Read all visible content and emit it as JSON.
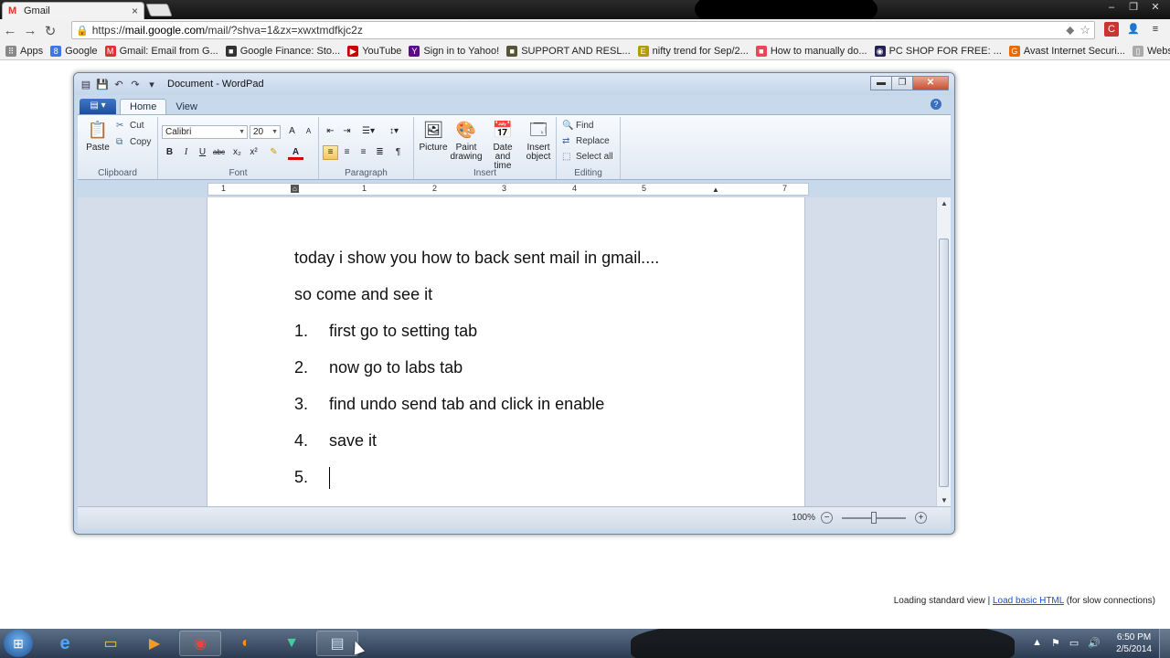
{
  "browser": {
    "tab_title": "Gmail",
    "tab_close": "×",
    "url_prefix": "https://",
    "url_host": "mail.google.com",
    "url_path": "/mail/?shva=1&zx=xwxtmdfkjc2z",
    "back": "←",
    "forward": "→",
    "reload": "↻",
    "window_buttons": [
      "–",
      "❐",
      "✕"
    ],
    "omnibox_icons": [
      "⬥",
      "☆"
    ],
    "extension_icons": [
      "C",
      "👤",
      "≡"
    ]
  },
  "bookmarks": [
    {
      "label": "Apps",
      "color": "#888",
      "glyph": "⠿"
    },
    {
      "label": "Google",
      "color": "#3b78e7",
      "glyph": "8"
    },
    {
      "label": "Gmail: Email from G...",
      "color": "#d33",
      "glyph": "M"
    },
    {
      "label": "Google Finance: Sto...",
      "color": "#333",
      "glyph": "■"
    },
    {
      "label": "YouTube",
      "color": "#c00",
      "glyph": "▶"
    },
    {
      "label": "Sign in to Yahoo!",
      "color": "#5c0b8a",
      "glyph": "Y"
    },
    {
      "label": "SUPPORT AND RESL...",
      "color": "#553",
      "glyph": "■"
    },
    {
      "label": "nifty trend for Sep/2...",
      "color": "#b59a00",
      "glyph": "E"
    },
    {
      "label": "How to manually do...",
      "color": "#e45",
      "glyph": "■"
    },
    {
      "label": "PC SHOP FOR FREE: ...",
      "color": "#225",
      "glyph": "◉"
    },
    {
      "label": "Avast Internet Securi...",
      "color": "#e86a00",
      "glyph": "G"
    },
    {
      "label": "Website Value Calcu...",
      "color": "#aaa",
      "glyph": "▯"
    }
  ],
  "wordpad": {
    "title": "Document - WordPad",
    "qat": [
      "▤",
      "↶",
      "↷",
      "▾"
    ],
    "controls": [
      "▬",
      "❐",
      "✕"
    ],
    "app_button": "▤ ▾",
    "tabs": [
      "Home",
      "View"
    ],
    "help": "?",
    "ribbon": {
      "clipboard": {
        "label": "Clipboard",
        "paste": "Paste",
        "cut": "Cut",
        "copy": "Copy"
      },
      "font": {
        "label": "Font",
        "family": "Calibri",
        "size": "20",
        "grow": "A",
        "shrink": "A",
        "bold": "B",
        "italic": "I",
        "underline": "U",
        "strike": "abc",
        "sub": "x₂",
        "sup": "x²",
        "highlight": "✎",
        "color": "A"
      },
      "paragraph": {
        "label": "Paragraph"
      },
      "insert": {
        "label": "Insert",
        "picture": "Picture",
        "paint": "Paint drawing",
        "datetime": "Date and time",
        "object": "Insert object"
      },
      "editing": {
        "label": "Editing",
        "find": "Find",
        "replace": "Replace",
        "select_all": "Select all"
      }
    },
    "ruler_ticks": [
      "1",
      "1",
      "2",
      "3",
      "4",
      "5",
      "6",
      "7"
    ],
    "document": {
      "lines": [
        "today i show you how to back sent mail in gmail....",
        "so come and see it"
      ],
      "list": [
        {
          "num": "1.",
          "text": "first go to setting tab"
        },
        {
          "num": "2.",
          "text": "now go to labs tab"
        },
        {
          "num": "3.",
          "text": "find undo send tab and click in enable"
        },
        {
          "num": "4.",
          "text": "save it"
        },
        {
          "num": "5.",
          "text": ""
        }
      ]
    },
    "zoom": "100%",
    "zoom_level": 100
  },
  "gmail_footer": {
    "loading": "Loading standard view |",
    "link": "Load basic HTML",
    "suffix": "(for slow connections)"
  },
  "taskbar": {
    "start": "⊞",
    "apps": [
      {
        "name": "ie",
        "glyph": "e"
      },
      {
        "name": "explorer",
        "glyph": "▭"
      },
      {
        "name": "media-player",
        "glyph": "▶"
      },
      {
        "name": "chrome",
        "glyph": "◉"
      },
      {
        "name": "firefox",
        "glyph": "◐"
      },
      {
        "name": "vpn",
        "glyph": "▼"
      },
      {
        "name": "wordpad",
        "glyph": "▤"
      }
    ],
    "tray": [
      "▲",
      "⚑",
      "▭",
      "🔊"
    ],
    "time": "6:50 PM",
    "date": "2/5/2014"
  },
  "colors": {
    "accent": "#1d4f9c",
    "link": "#1155cc"
  }
}
